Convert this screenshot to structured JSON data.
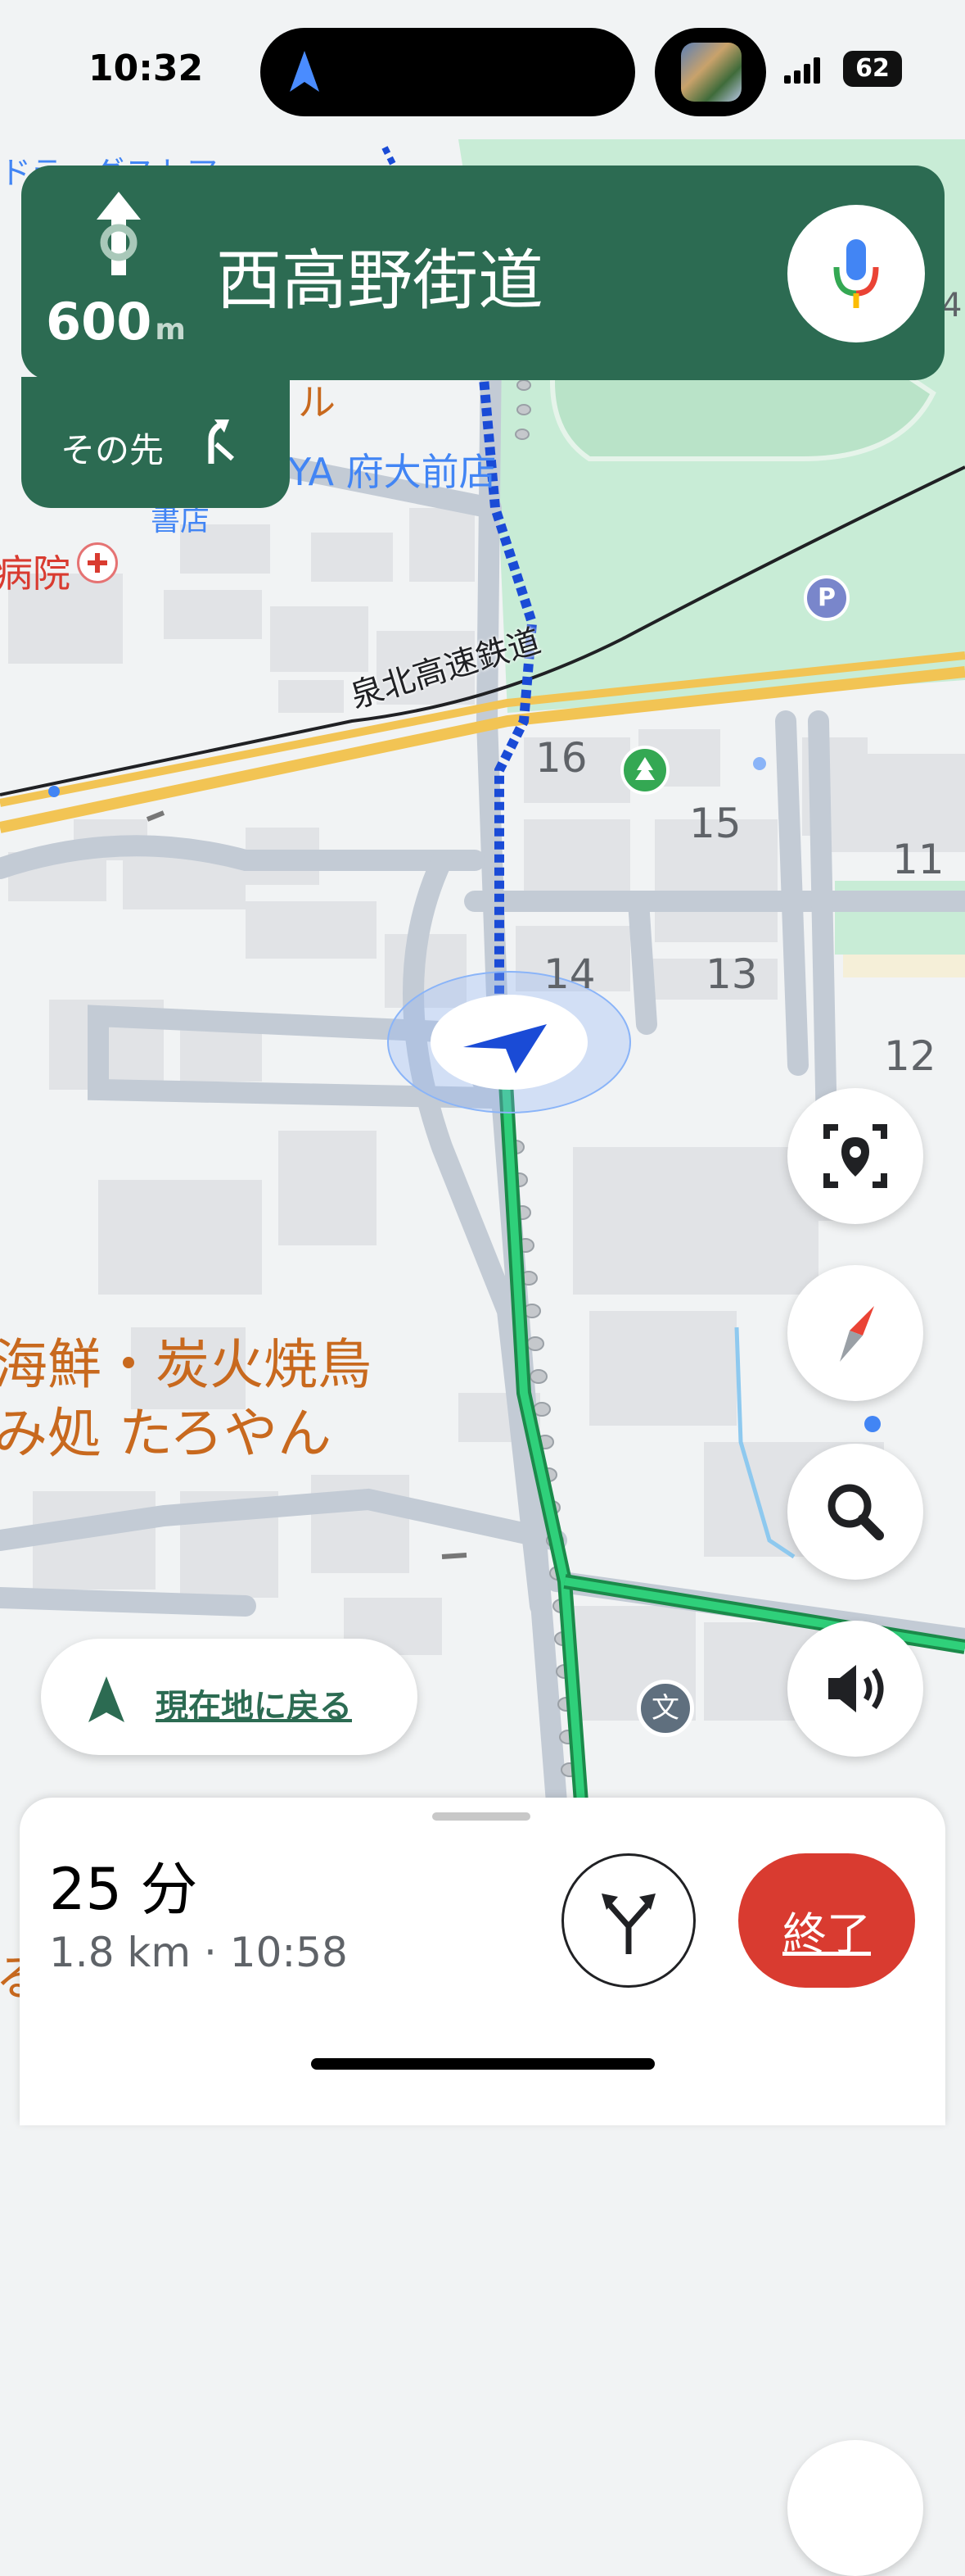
{
  "status_bar": {
    "time": "10:32",
    "battery": "62"
  },
  "navigation": {
    "distance_value": "600",
    "distance_unit": "m",
    "street_name": "西高野街道",
    "then_label": "その先"
  },
  "map": {
    "labels": {
      "drugstore": "ドラッグストア",
      "station": "YA 府大前店",
      "shop": "書店",
      "hospital": "病院",
      "railway": "泉北高速鉄道",
      "block_16": "16",
      "block_15": "15",
      "block_11": "11",
      "block_14": "14",
      "block_13": "13",
      "block_12": "12",
      "restaurant_line1": "海鮮・炭火焼鳥",
      "restaurant_line2": "み処 たろやん",
      "park_marker": "P",
      "school_marker": "文",
      "partial_left": "ル",
      "partial_right": "4",
      "partial_bottom": "る"
    }
  },
  "recenter_label": "現在地に戻る",
  "trip": {
    "duration": "25 分",
    "details": "1.8 km · 10:58",
    "end_label": "終了"
  },
  "colors": {
    "nav_green": "#2c6b52",
    "route_green": "#2fd07a",
    "route_blue": "#1a4bd6",
    "end_red": "#d93b30",
    "poi_orange": "#c8691e"
  },
  "icons": [
    "navigation-arrow-icon",
    "straight-arrow-icon",
    "microphone-icon",
    "turn-right-icon",
    "location-scan-icon",
    "compass-icon",
    "search-icon",
    "volume-icon",
    "alternate-routes-icon",
    "park-icon",
    "school-icon",
    "parking-icon",
    "hospital-icon",
    "user-location-icon"
  ]
}
